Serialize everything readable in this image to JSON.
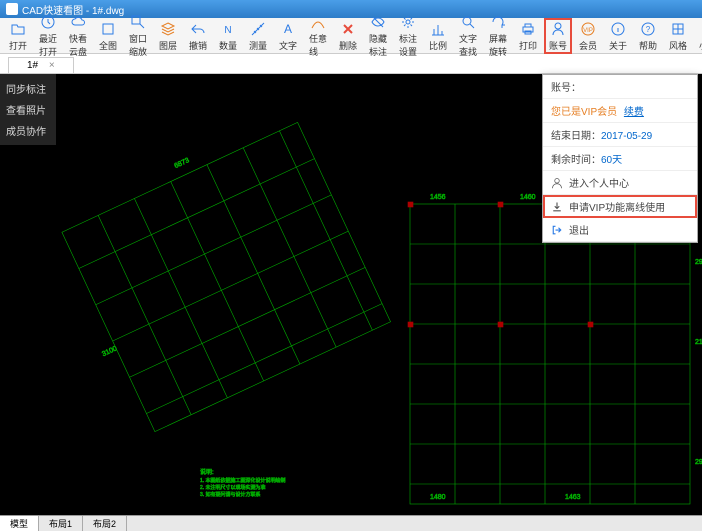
{
  "title": "CAD快速看图 - 1#.dwg",
  "toolbar": [
    {
      "label": "打开",
      "icon": "folder",
      "color": "#2c7be5"
    },
    {
      "label": "最近打开",
      "icon": "clock",
      "color": "#2c7be5"
    },
    {
      "label": "快看云盘",
      "icon": "cloud",
      "color": "#2c7be5"
    },
    {
      "label": "全图",
      "icon": "fullscreen",
      "color": "#2c7be5"
    },
    {
      "label": "窗口缩放",
      "icon": "zoom-window",
      "color": "#2c7be5"
    },
    {
      "label": "图层",
      "icon": "layers",
      "color": "#e67e22"
    },
    {
      "label": "撤销",
      "icon": "undo",
      "color": "#2c7be5"
    },
    {
      "label": "数量",
      "icon": "count",
      "color": "#2c7be5"
    },
    {
      "label": "测量",
      "icon": "measure",
      "color": "#2c7be5"
    },
    {
      "label": "文字",
      "icon": "text",
      "color": "#2c7be5"
    },
    {
      "label": "任意线",
      "icon": "line",
      "color": "#e67e22"
    },
    {
      "label": "删除",
      "icon": "delete",
      "color": "#e74c3c"
    },
    {
      "label": "隐藏标注",
      "icon": "hide",
      "color": "#2c7be5"
    },
    {
      "label": "标注设置",
      "icon": "settings",
      "color": "#2c7be5"
    },
    {
      "label": "比例",
      "icon": "scale",
      "color": "#2c7be5"
    },
    {
      "label": "文字查找",
      "icon": "search",
      "color": "#2c7be5"
    },
    {
      "label": "屏幕旋转",
      "icon": "rotate",
      "color": "#2c7be5"
    },
    {
      "label": "打印",
      "icon": "print",
      "color": "#2c7be5"
    },
    {
      "label": "账号",
      "icon": "user",
      "color": "#2c7be5",
      "highlighted": true
    },
    {
      "label": "会员",
      "icon": "vip",
      "color": "#e67e22"
    },
    {
      "label": "关于",
      "icon": "info",
      "color": "#2c7be5"
    },
    {
      "label": "帮助",
      "icon": "help",
      "color": "#2c7be5"
    },
    {
      "label": "风格",
      "icon": "style",
      "color": "#2c7be5"
    },
    {
      "label": "小站",
      "icon": "site",
      "color": "#2c7be5"
    }
  ],
  "tab": {
    "label": "1#",
    "close": "×"
  },
  "side_panel": [
    "同步标注",
    "查看照片",
    "成员协作"
  ],
  "account_menu": {
    "account_label": "账号：",
    "vip_status": "您已是VIP会员",
    "renew_link": "续费",
    "end_date_label": "结束日期：",
    "end_date": "2017-05-29",
    "remain_label": "剩余时间：",
    "remain": "60天",
    "enter_center": "进入个人中心",
    "apply_vip": "申请VIP功能离线使用",
    "logout": "退出"
  },
  "bottom_tabs": [
    "模型",
    "布局1",
    "布局2"
  ]
}
